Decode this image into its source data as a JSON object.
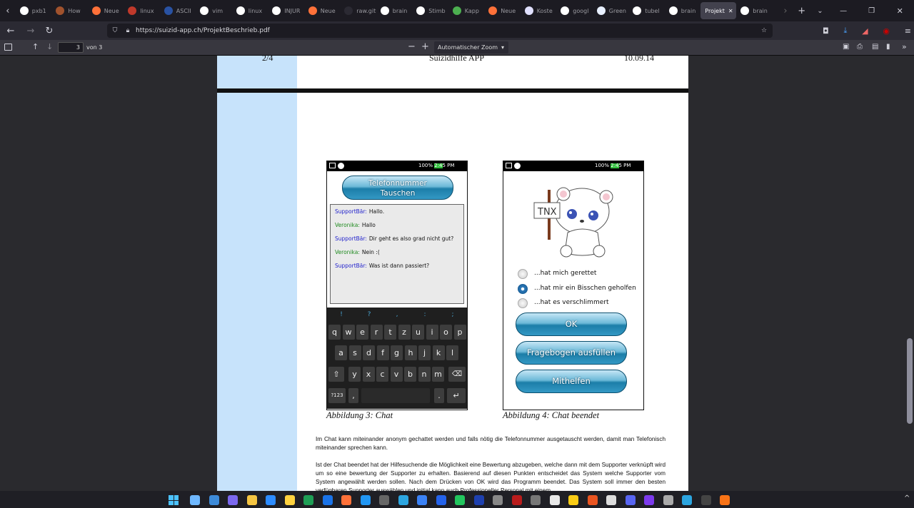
{
  "browser": {
    "tabs": [
      {
        "label": "pxb1",
        "icon": "github-icon",
        "color": "#ffffff"
      },
      {
        "label": "How",
        "icon": "page-icon",
        "color": "#a0522d"
      },
      {
        "label": "Neue",
        "icon": "firefox-icon",
        "color": "#ff7139"
      },
      {
        "label": "linux",
        "icon": "page-icon",
        "color": "#c0392b"
      },
      {
        "label": "ASCII",
        "icon": "page-icon",
        "color": "#2952a3"
      },
      {
        "label": "vim",
        "icon": "google-icon",
        "color": "#ffffff"
      },
      {
        "label": "linux",
        "icon": "google-icon",
        "color": "#ffffff"
      },
      {
        "label": "INJUR",
        "icon": "google-icon",
        "color": "#ffffff"
      },
      {
        "label": "Neue",
        "icon": "firefox-icon",
        "color": "#ff7139"
      },
      {
        "label": "raw.githul",
        "icon": "page-icon",
        "color": "#2b2a33"
      },
      {
        "label": "brain",
        "icon": "github-icon",
        "color": "#ffffff"
      },
      {
        "label": "Stimb",
        "icon": "page-icon",
        "color": "#ffffff"
      },
      {
        "label": "Kapp",
        "icon": "pin-icon",
        "color": "#4caf50"
      },
      {
        "label": "Neue",
        "icon": "firefox-icon",
        "color": "#ff7139"
      },
      {
        "label": "Koste",
        "icon": "chat-icon",
        "color": "#e0e0ff"
      },
      {
        "label": "googl",
        "icon": "google-icon",
        "color": "#ffffff"
      },
      {
        "label": "Green",
        "icon": "page-icon",
        "color": "#e8f0ff"
      },
      {
        "label": "tubel",
        "icon": "github-icon",
        "color": "#ffffff"
      },
      {
        "label": "brain",
        "icon": "github-icon",
        "color": "#ffffff"
      },
      {
        "label": "Projekt",
        "icon": "pdf-icon",
        "color": "#42414d",
        "active": true
      },
      {
        "label": "brain",
        "icon": "github-icon",
        "color": "#ffffff"
      }
    ],
    "url": "https://suizid-app.ch/ProjektBeschrieb.pdf"
  },
  "pdf_toolbar": {
    "page_value": "3",
    "page_of": "von 3",
    "zoom_label": "Automatischer Zoom"
  },
  "page2_footer": {
    "left": "2/4",
    "center": "Suizidhilfe APP",
    "right": "10.09.14"
  },
  "figure3": {
    "status_text": "100%  2:45 PM",
    "button_label_1": "Telefonnummer",
    "button_label_2": "Tauschen",
    "chat": [
      {
        "speaker": "SupportBär:",
        "text": "Hallo.",
        "color": "#2222cc"
      },
      {
        "speaker": "Veronika:",
        "text": "Hallo",
        "color": "#1e8a1e"
      },
      {
        "speaker": "SupportBär:",
        "text": "Dir geht es also grad nicht gut?",
        "color": "#2222cc"
      },
      {
        "speaker": "Veronika:",
        "text": "Nein :(",
        "color": "#1e8a1e"
      },
      {
        "speaker": "SupportBär:",
        "text": "Was ist dann passiert?",
        "color": "#2222cc"
      }
    ],
    "keyboard": {
      "row0": [
        "!",
        "?",
        ",",
        ":",
        ";"
      ],
      "row1": [
        "q",
        "w",
        "e",
        "r",
        "t",
        "z",
        "u",
        "i",
        "o",
        "p"
      ],
      "row2": [
        "a",
        "s",
        "d",
        "f",
        "g",
        "h",
        "j",
        "k",
        "l"
      ],
      "row3": [
        "y",
        "x",
        "c",
        "v",
        "b",
        "n",
        "m"
      ],
      "key_123": "?123",
      "key_comma": ",",
      "key_dot": "."
    },
    "caption": "Abbildung 3: Chat"
  },
  "figure4": {
    "status_text": "100%  2:45 PM",
    "sign_text": "TNX",
    "options": [
      {
        "label": "...hat mich gerettet",
        "selected": false
      },
      {
        "label": "...hat mir ein Bisschen geholfen",
        "selected": true
      },
      {
        "label": "...hat es verschlimmert",
        "selected": false
      }
    ],
    "buttons": [
      "OK",
      "Fragebogen ausfüllen",
      "Mithelfen"
    ],
    "caption": "Abbildung 4: Chat beendet"
  },
  "paragraphs": [
    "Im Chat kann miteinander anonym gechattet werden und falls nötig die Telefonnummer ausgetauscht werden, damit man Telefonisch miteinander sprechen kann.",
    "Ist der Chat beendet hat der Hilfesuchende die Möglichkeit eine Bewertung abzugeben, welche dann mit dem Supporter verknüpft wird um so eine bewertung der Supporter zu erhalten. Basierend auf diesen Punkten entscheidet das System welche Supporter vom System angewählt werden sollen. Nach dem Drücken von OK wird das Programm beendet. Das System soll immer den besten verfügbaren Supporter auswählen und initial kann auch Professioneller Personal mit einem"
  ]
}
